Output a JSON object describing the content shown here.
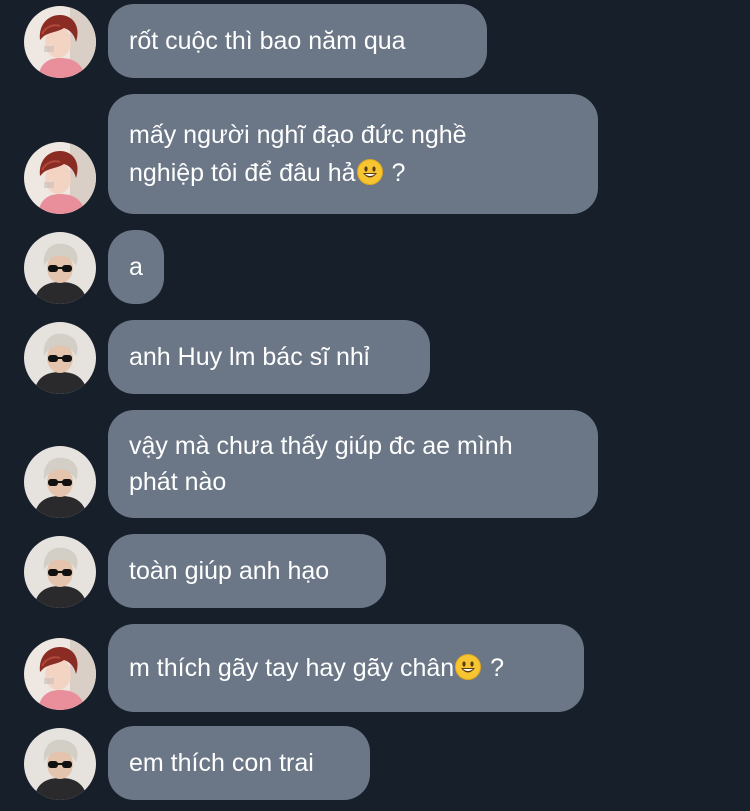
{
  "colors": {
    "background": "#161f2a",
    "bubble": "#6b7786",
    "text": "#ffffff"
  },
  "messages": [
    {
      "sender": "red-hair",
      "avatar_icon": "red-hair-avatar-icon",
      "text": "rốt cuộc thì bao năm qua",
      "emoji": false,
      "text_after": ""
    },
    {
      "sender": "red-hair",
      "avatar_icon": "red-hair-avatar-icon",
      "text": "mấy người nghĩ đạo đức nghề\nnghiệp tôi để đâu hả",
      "emoji": true,
      "text_after": " ?"
    },
    {
      "sender": "sunglasses",
      "avatar_icon": "sunglasses-avatar-icon",
      "text": "a",
      "emoji": false,
      "text_after": ""
    },
    {
      "sender": "sunglasses",
      "avatar_icon": "sunglasses-avatar-icon",
      "text": "anh Huy lm bác sĩ nhỉ",
      "emoji": false,
      "text_after": ""
    },
    {
      "sender": "sunglasses",
      "avatar_icon": "sunglasses-avatar-icon",
      "text": "vậy mà chưa thấy giúp đc ae mình\nphát nào",
      "emoji": false,
      "text_after": ""
    },
    {
      "sender": "sunglasses",
      "avatar_icon": "sunglasses-avatar-icon",
      "text": "toàn giúp anh hạo",
      "emoji": false,
      "text_after": ""
    },
    {
      "sender": "red-hair",
      "avatar_icon": "red-hair-avatar-icon",
      "text": "m thích gãy tay hay gãy chân",
      "emoji": true,
      "text_after": " ?"
    },
    {
      "sender": "sunglasses",
      "avatar_icon": "sunglasses-avatar-icon",
      "text": "em thích con trai",
      "emoji": false,
      "text_after": ""
    }
  ]
}
